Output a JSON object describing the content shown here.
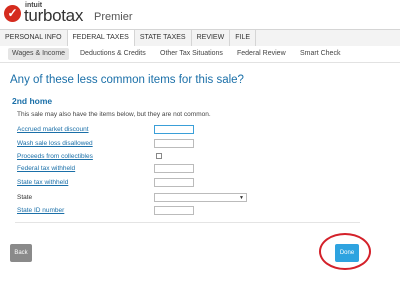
{
  "brand": {
    "mark": "✓",
    "maker": "intuit",
    "product": "turbotax",
    "edition": "Premier",
    "mark_color": "#d52b1e"
  },
  "top_nav": {
    "items": [
      "PERSONAL INFO",
      "FEDERAL TAXES",
      "STATE TAXES",
      "REVIEW",
      "FILE"
    ],
    "active": "FEDERAL TAXES"
  },
  "sub_nav": {
    "items": [
      "Wages & Income",
      "Deductions & Credits",
      "Other Tax Situations",
      "Federal Review",
      "Smart Check"
    ],
    "active": "Wages & Income"
  },
  "main": {
    "question": "Any of these less common items for this sale?",
    "section_title": "2nd home",
    "description": "This sale may also have the items below, but they are not common.",
    "accent_color": "#1a6fa8"
  },
  "form": {
    "accrued_market_discount": {
      "label": "Accrued market discount",
      "value": ""
    },
    "wash_sale_loss_disallowed": {
      "label": "Wash sale loss disallowed",
      "value": ""
    },
    "proceeds_from_collectibles": {
      "label": "Proceeds from collectibles",
      "checked": false
    },
    "federal_tax_withheld": {
      "label": "Federal tax withheld",
      "value": ""
    },
    "state_tax_withheld": {
      "label": "State tax withheld",
      "value": ""
    },
    "state": {
      "label": "State",
      "selected": ""
    },
    "state_id_number": {
      "label": "State ID number",
      "value": ""
    }
  },
  "buttons": {
    "back": "Back",
    "done": "Done",
    "done_color": "#2ea3e0"
  },
  "annotation": {
    "color": "#d4212a",
    "target": "Done"
  }
}
